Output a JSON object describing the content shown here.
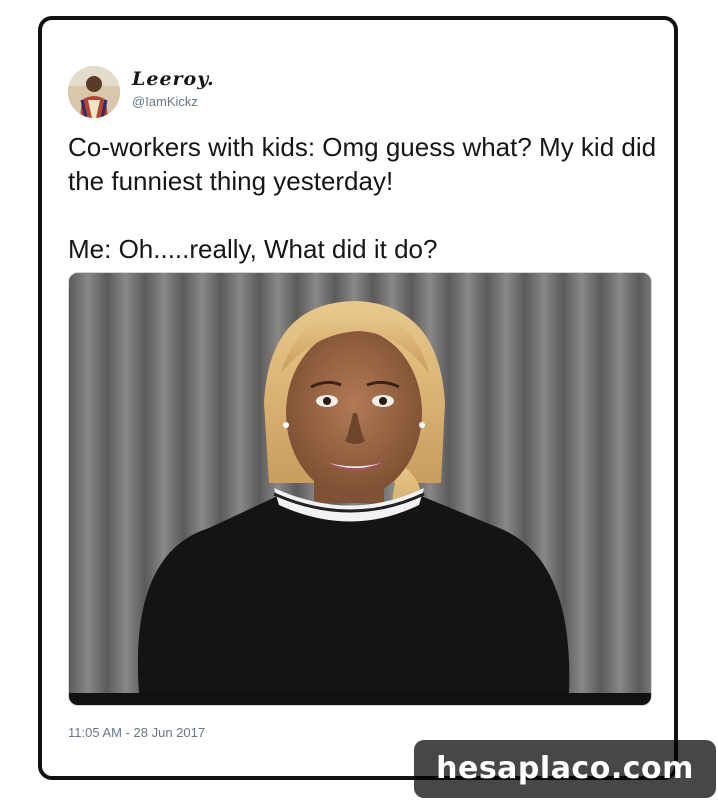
{
  "tweet": {
    "display_name": "Leeroy.",
    "handle": "@IamKickz",
    "text_line_1": "Co-workers with kids: Omg guess what? My kid did the funniest thing yesterday!",
    "text_line_2": "Me: Oh.....really, What did it do?",
    "timestamp": "11:05 AM - 28 Jun 2017"
  },
  "watermark": {
    "text": "hesaplaco.com"
  },
  "colors": {
    "text_primary": "#14171a",
    "text_secondary": "#657786",
    "card_border": "#111111",
    "watermark_bg": "#000000"
  },
  "media": {
    "description_icon": "photo-woman-smiling"
  }
}
